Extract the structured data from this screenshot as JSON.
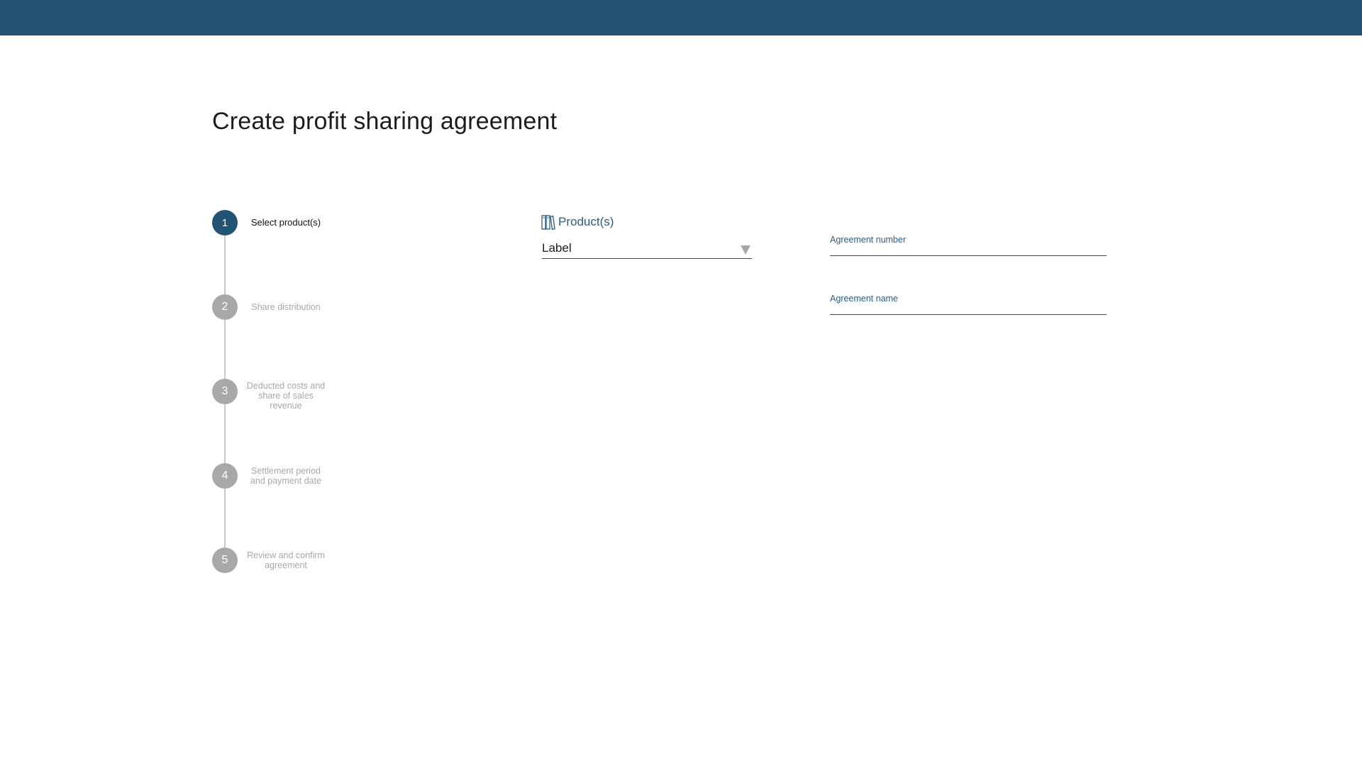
{
  "colors": {
    "topbar": "#225373",
    "accent": "#2a5d86",
    "step_inactive": "#a8a8a8"
  },
  "page": {
    "title": "Create profit sharing agreement"
  },
  "stepper": {
    "active_step": 1,
    "steps": [
      {
        "number": "1",
        "label": "Select product(s)"
      },
      {
        "number": "2",
        "label": "Share distribution"
      },
      {
        "number": "3",
        "label": "Deducted costs and share of sales revenue"
      },
      {
        "number": "4",
        "label": "Settlement period and payment date"
      },
      {
        "number": "5",
        "label": "Review and confirm agreement"
      }
    ]
  },
  "products": {
    "header": "Product(s)",
    "icon": "books-icon",
    "select_value": "Label"
  },
  "fields": {
    "agreement_number_label": "Agreement number",
    "agreement_number_value": "",
    "agreement_name_label": "Agreement name",
    "agreement_name_value": ""
  }
}
